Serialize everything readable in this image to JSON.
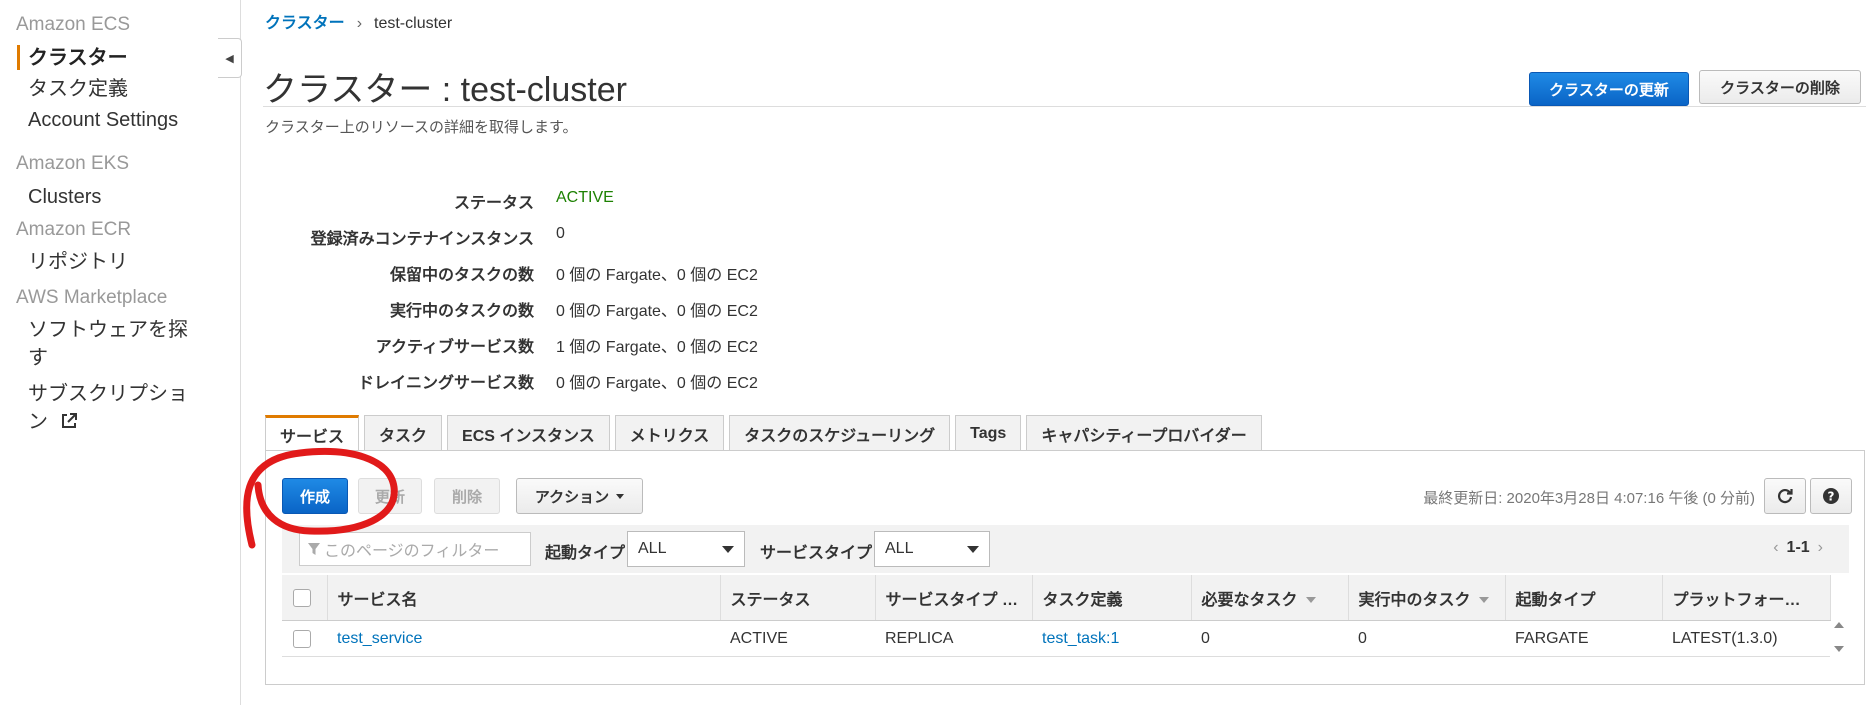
{
  "sidebar": {
    "sections": [
      {
        "title": "Amazon ECS",
        "items": [
          {
            "label": "クラスター",
            "active": true
          },
          {
            "label": "タスク定義"
          },
          {
            "label": "Account Settings"
          }
        ]
      },
      {
        "title": "Amazon EKS",
        "items": [
          {
            "label": "Clusters"
          }
        ]
      },
      {
        "title": "Amazon ECR",
        "items": [
          {
            "label": "リポジトリ"
          }
        ]
      },
      {
        "title": "AWS Marketplace",
        "items": [
          {
            "label": "ソフトウェアを探",
            "label_cont": "す"
          },
          {
            "label": "サブスクリプショ",
            "label_cont": "ン"
          }
        ]
      }
    ]
  },
  "breadcrumb": {
    "parent": "クラスター",
    "separator": "›",
    "current": "test-cluster"
  },
  "header": {
    "title": "クラスター : test-cluster",
    "subtitle": "クラスター上のリソースの詳細を取得します。",
    "update_button": "クラスターの更新",
    "delete_button": "クラスターの削除"
  },
  "details": [
    {
      "label": "ステータス",
      "value": "ACTIVE"
    },
    {
      "label": "登録済みコンテナインスタンス",
      "value": "0"
    },
    {
      "label": "保留中のタスクの数",
      "value": "0 個の Fargate、0 個の EC2"
    },
    {
      "label": "実行中のタスクの数",
      "value": "0 個の Fargate、0 個の EC2"
    },
    {
      "label": "アクティブサービス数",
      "value": "1 個の Fargate、0 個の EC2"
    },
    {
      "label": "ドレイニングサービス数",
      "value": "0 個の Fargate、0 個の EC2"
    }
  ],
  "tabs": [
    "サービス",
    "タスク",
    "ECS インスタンス",
    "メトリクス",
    "タスクのスケジューリング",
    "Tags",
    "キャパシティープロバイダー"
  ],
  "toolbar": {
    "create": "作成",
    "update": "更新",
    "delete": "削除",
    "actions": "アクション",
    "last_updated": "最終更新日: 2020年3月28日 4:07:16 午後 (0 分前)"
  },
  "filter": {
    "placeholder": "このページのフィルター",
    "launch_type_label": "起動タイプ",
    "launch_type_value": "ALL",
    "service_type_label": "サービスタイプ",
    "service_type_value": "ALL",
    "pagination": "1-1"
  },
  "table": {
    "columns": [
      "サービス名",
      "ステータス",
      "サービスタイプ …",
      "タスク定義",
      "必要なタスク",
      "実行中のタスク",
      "起動タイプ",
      "プラットフォー…"
    ],
    "rows": [
      {
        "service_name": "test_service",
        "status": "ACTIVE",
        "service_type": "REPLICA",
        "task_definition": "test_task:1",
        "desired_tasks": "0",
        "running_tasks": "0",
        "launch_type": "FARGATE",
        "platform": "LATEST(1.3.0)"
      }
    ]
  },
  "colors": {
    "accent_orange": "#e07b00",
    "primary_blue": "#0a64c6",
    "link_blue": "#0073bb",
    "active_green": "#1d8102",
    "annotation_red": "#e11a1a"
  }
}
